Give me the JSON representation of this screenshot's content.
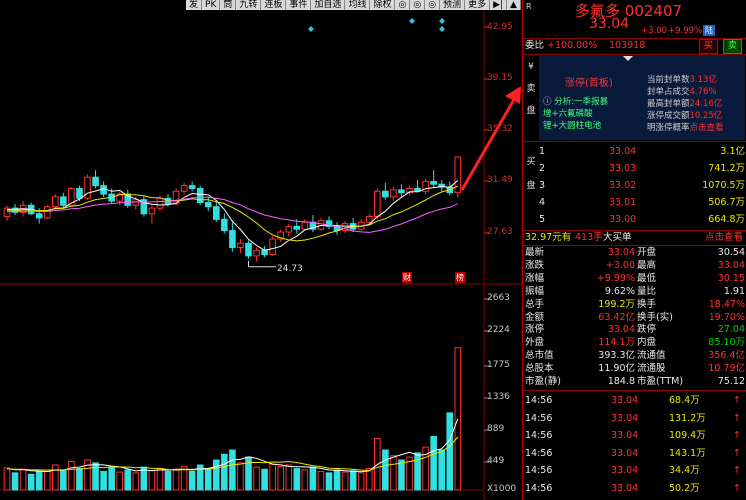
{
  "toolbar": [
    "发",
    "PK",
    "筒",
    "九转",
    "连板",
    "事件",
    "加自选",
    "均线",
    "除权",
    "",
    "",
    "",
    "预测",
    "更多"
  ],
  "price_axis": [
    "42.95",
    "39.15",
    "35.32",
    "31.49",
    "27.63"
  ],
  "low_marker": "24.73",
  "vol_axis": [
    "2663",
    "2224",
    "1775",
    "1336",
    "889",
    "449",
    "X1000"
  ],
  "markers": {
    "cai": "财",
    "bang": "榜"
  },
  "stock": {
    "name": "多氟多",
    "code": "002407",
    "price": "33.04",
    "change": "+3.00",
    "pct": "+9.99%",
    "badge": "陆",
    "r_label": "R"
  },
  "weibi": {
    "label": "委比",
    "value": "+100.00%",
    "count": "103918",
    "buy": "买",
    "sell": "卖"
  },
  "limit_up": {
    "title": "涨停(首板)",
    "bullets": [
      "分析:一季报暴",
      "增+六氟磷酸",
      "锂+大圆柱电池"
    ],
    "stats": [
      {
        "k": "当前封单数",
        "v": "3.13亿"
      },
      {
        "k": "封单占成交",
        "v": "4.76%"
      },
      {
        "k": "最高封单额",
        "v": "24.16亿"
      },
      {
        "k": "涨停成交额",
        "v": "10.25亿"
      },
      {
        "k": "明涨停概率",
        "v": "点击查看"
      }
    ],
    "side": [
      "¥",
      "卖",
      "盘"
    ]
  },
  "buy_book": {
    "side": [
      "买",
      "盘"
    ],
    "rows": [
      {
        "n": "1",
        "p": "33.04",
        "v": "3.1亿"
      },
      {
        "n": "2",
        "p": "33.03",
        "v": "741.2万"
      },
      {
        "n": "3",
        "p": "33.02",
        "v": "1070.5万"
      },
      {
        "n": "4",
        "p": "33.01",
        "v": "506.7万"
      },
      {
        "n": "5",
        "p": "33.00",
        "v": "664.8万"
      }
    ]
  },
  "big_order": {
    "price": "32.97元有",
    "qty": "413手",
    "label": "大买单",
    "link": "点击查看"
  },
  "quote": [
    {
      "k1": "最新",
      "v1": "33.04",
      "k2": "开盘",
      "v2": "30.54"
    },
    {
      "k1": "涨跌",
      "v1": "+3.00",
      "k2": "最高",
      "v2": "33.04"
    },
    {
      "k1": "涨幅",
      "v1": "+9.99%",
      "k2": "最低",
      "v2": "30.15"
    },
    {
      "k1": "振幅",
      "v1": "9.62%",
      "k2": "量比",
      "v2": "1.91"
    },
    {
      "k1": "总手",
      "v1": "199.2万",
      "k2": "换手",
      "v2": "18.47%"
    },
    {
      "k1": "金额",
      "v1": "63.42亿",
      "k2": "换手(实)",
      "v2": "19.70%"
    },
    {
      "k1": "涨停",
      "v1": "33.04",
      "k2": "跌停",
      "v2": "27.04"
    },
    {
      "k1": "外盘",
      "v1": "114.1万",
      "k2": "内盘",
      "v2": "85.10万"
    },
    {
      "k1": "总市值",
      "v1": "393.3亿",
      "k2": "流通值",
      "v2": "356.4亿"
    },
    {
      "k1": "总股本",
      "v1": "11.90亿",
      "k2": "流通股",
      "v2": "10.79亿"
    },
    {
      "k1": "市盈(静)",
      "v1": "184.8",
      "k2": "市盈(TTM)",
      "v2": "75.12"
    }
  ],
  "ticks": [
    {
      "t": "14:56",
      "p": "33.04",
      "v": "68.4万"
    },
    {
      "t": "14:56",
      "p": "33.04",
      "v": "131.2万"
    },
    {
      "t": "14:56",
      "p": "33.04",
      "v": "109.4万"
    },
    {
      "t": "14:56",
      "p": "33.04",
      "v": "143.1万"
    },
    {
      "t": "14:56",
      "p": "33.04",
      "v": "34.4万"
    },
    {
      "t": "14:56",
      "p": "33.04",
      "v": "50.2万"
    }
  ],
  "colors": {
    "up": "#ff3030",
    "down": "#30e0e0",
    "ma5": "#ffffff",
    "ma10": "#e8e800",
    "ma20": "#ff60ff",
    "grid": "#8b0000"
  },
  "kline": [
    [
      28.8,
      29.6,
      28.5,
      29.4
    ],
    [
      29.4,
      29.7,
      28.9,
      29.1
    ],
    [
      29.1,
      29.9,
      28.8,
      29.6
    ],
    [
      29.6,
      29.8,
      28.9,
      29.0
    ],
    [
      29.0,
      29.4,
      28.3,
      28.7
    ],
    [
      28.7,
      29.6,
      28.6,
      29.5
    ],
    [
      29.5,
      30.4,
      29.3,
      30.2
    ],
    [
      30.2,
      30.5,
      29.4,
      29.6
    ],
    [
      29.6,
      30.9,
      29.5,
      30.8
    ],
    [
      30.8,
      31.0,
      29.9,
      30.1
    ],
    [
      30.1,
      31.8,
      30.0,
      31.6
    ],
    [
      31.6,
      32.1,
      30.8,
      31.0
    ],
    [
      31.0,
      31.3,
      30.2,
      30.4
    ],
    [
      30.4,
      30.8,
      29.7,
      29.9
    ],
    [
      29.9,
      30.6,
      29.6,
      30.4
    ],
    [
      30.4,
      30.7,
      29.4,
      29.6
    ],
    [
      29.6,
      30.2,
      29.3,
      30.0
    ],
    [
      30.0,
      30.3,
      28.8,
      29.0
    ],
    [
      29.0,
      29.6,
      28.3,
      29.4
    ],
    [
      29.4,
      30.3,
      29.2,
      30.1
    ],
    [
      30.1,
      30.4,
      29.5,
      29.7
    ],
    [
      29.7,
      30.8,
      29.6,
      30.6
    ],
    [
      30.6,
      31.2,
      30.4,
      31.0
    ],
    [
      31.0,
      31.3,
      30.6,
      30.8
    ],
    [
      30.8,
      31.0,
      29.6,
      29.8
    ],
    [
      29.8,
      30.2,
      29.2,
      29.5
    ],
    [
      29.5,
      29.9,
      28.4,
      28.6
    ],
    [
      28.6,
      29.0,
      27.6,
      27.8
    ],
    [
      27.8,
      28.4,
      26.3,
      26.6
    ],
    [
      26.6,
      27.2,
      26.2,
      26.9
    ],
    [
      26.9,
      27.1,
      25.8,
      26.0
    ],
    [
      26.0,
      26.6,
      25.6,
      26.4
    ],
    [
      26.4,
      26.7,
      25.9,
      26.1
    ],
    [
      26.1,
      27.4,
      26.0,
      27.2
    ],
    [
      27.2,
      27.9,
      27.0,
      27.7
    ],
    [
      27.7,
      28.3,
      27.4,
      28.1
    ],
    [
      28.1,
      28.6,
      27.6,
      27.9
    ],
    [
      27.9,
      28.6,
      27.8,
      28.4
    ],
    [
      28.4,
      28.9,
      27.7,
      27.9
    ],
    [
      27.9,
      28.7,
      27.8,
      28.5
    ],
    [
      28.5,
      28.8,
      27.9,
      28.1
    ],
    [
      28.1,
      28.4,
      27.5,
      27.8
    ],
    [
      27.8,
      28.5,
      27.6,
      28.3
    ],
    [
      28.3,
      28.7,
      27.7,
      27.9
    ],
    [
      27.9,
      28.6,
      27.8,
      28.4
    ],
    [
      28.4,
      29.0,
      28.2,
      28.8
    ],
    [
      28.8,
      30.8,
      28.6,
      30.6
    ],
    [
      30.6,
      31.2,
      30.0,
      30.2
    ],
    [
      30.2,
      30.9,
      29.9,
      30.7
    ],
    [
      30.7,
      31.1,
      30.2,
      30.5
    ],
    [
      30.5,
      31.0,
      30.3,
      30.8
    ],
    [
      30.8,
      31.4,
      30.5,
      30.6
    ],
    [
      30.6,
      31.5,
      30.4,
      31.3
    ],
    [
      31.3,
      32.1,
      30.9,
      31.1
    ],
    [
      31.1,
      31.4,
      30.6,
      30.9
    ],
    [
      30.9,
      31.3,
      30.3,
      30.5
    ],
    [
      30.5,
      33.04,
      30.15,
      33.04
    ]
  ],
  "volume": [
    [
      310,
      1
    ],
    [
      240,
      0
    ],
    [
      290,
      1
    ],
    [
      220,
      0
    ],
    [
      260,
      0
    ],
    [
      280,
      1
    ],
    [
      350,
      1
    ],
    [
      270,
      0
    ],
    [
      400,
      1
    ],
    [
      300,
      0
    ],
    [
      420,
      1
    ],
    [
      380,
      0
    ],
    [
      260,
      0
    ],
    [
      310,
      0
    ],
    [
      250,
      1
    ],
    [
      280,
      0
    ],
    [
      240,
      1
    ],
    [
      320,
      0
    ],
    [
      270,
      1
    ],
    [
      300,
      1
    ],
    [
      260,
      0
    ],
    [
      290,
      1
    ],
    [
      330,
      1
    ],
    [
      260,
      0
    ],
    [
      350,
      0
    ],
    [
      280,
      0
    ],
    [
      420,
      0
    ],
    [
      500,
      0
    ],
    [
      560,
      0
    ],
    [
      380,
      1
    ],
    [
      460,
      0
    ],
    [
      320,
      1
    ],
    [
      290,
      0
    ],
    [
      360,
      1
    ],
    [
      330,
      1
    ],
    [
      350,
      1
    ],
    [
      300,
      0
    ],
    [
      280,
      1
    ],
    [
      320,
      0
    ],
    [
      260,
      1
    ],
    [
      240,
      0
    ],
    [
      280,
      0
    ],
    [
      250,
      1
    ],
    [
      270,
      0
    ],
    [
      240,
      1
    ],
    [
      300,
      1
    ],
    [
      720,
      1
    ],
    [
      560,
      0
    ],
    [
      480,
      1
    ],
    [
      420,
      0
    ],
    [
      460,
      1
    ],
    [
      520,
      0
    ],
    [
      600,
      1
    ],
    [
      750,
      0
    ],
    [
      560,
      0
    ],
    [
      1080,
      0
    ],
    [
      1992,
      1
    ]
  ]
}
